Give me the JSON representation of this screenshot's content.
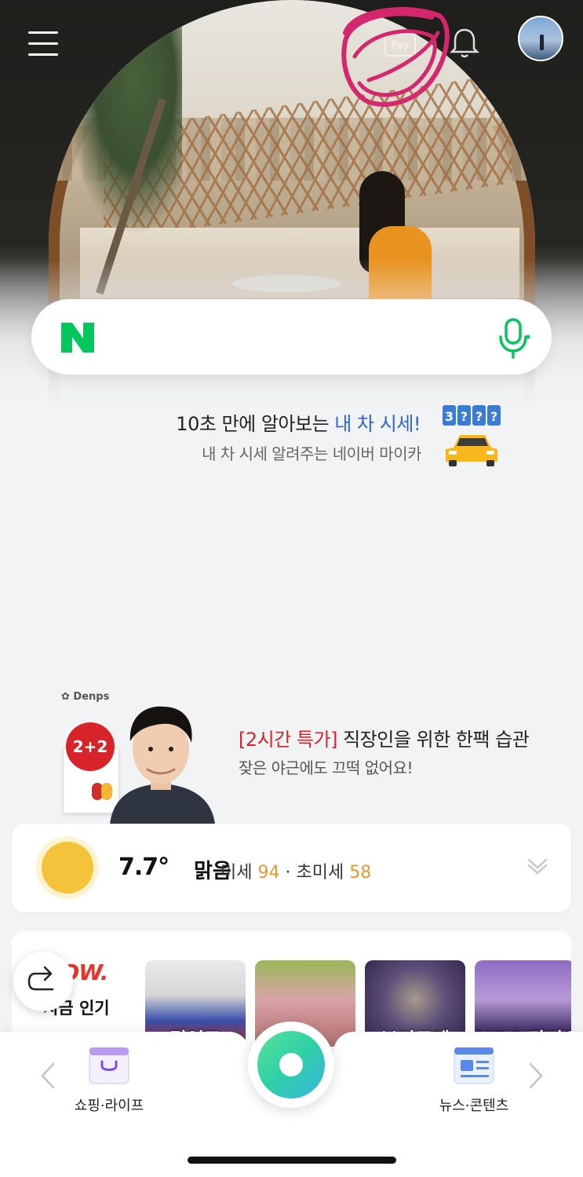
{
  "search": {
    "placeholder": ""
  },
  "header": {
    "pay_label": "Pay"
  },
  "promo_car": {
    "title_prefix": "10초 만에 알아보는 ",
    "title_highlight": "내 차 시세!",
    "subtitle": "내 차 시세 알려주는 네이버 마이카",
    "counter": [
      "3",
      "?",
      "?",
      "?"
    ]
  },
  "promo_ad": {
    "brand": "Denps",
    "badge": "2+2",
    "title_highlight": "[2시간 특가]",
    "title_rest": " 직장인을 위한 한팩 습관",
    "subtitle": "잦은 야근에도 끄떡 없어요!"
  },
  "weather": {
    "temperature": "7.7°",
    "condition": "맑음",
    "fine_dust_label": "미세",
    "fine_dust_value": "94",
    "separator": " · ",
    "ultrafine_dust_label": "초미세",
    "ultrafine_dust_value": "58"
  },
  "now": {
    "logo": "NOW.",
    "subtitle": "지금 인기",
    "thumbnails": [
      {
        "caption": "김연도"
      },
      {
        "caption": ""
      },
      {
        "caption": "보디도레"
      },
      {
        "caption": "MBC 라디오"
      }
    ]
  },
  "bottom_nav": {
    "left_label": "쇼핑·라이프",
    "right_label": "뉴스·콘텐츠"
  },
  "colors": {
    "naver_green": "#03c75a",
    "link_blue": "#2f64d6",
    "dust_orange": "#e69a2e",
    "ad_red": "#d9232a",
    "annotation_pink": "#d6266e"
  }
}
